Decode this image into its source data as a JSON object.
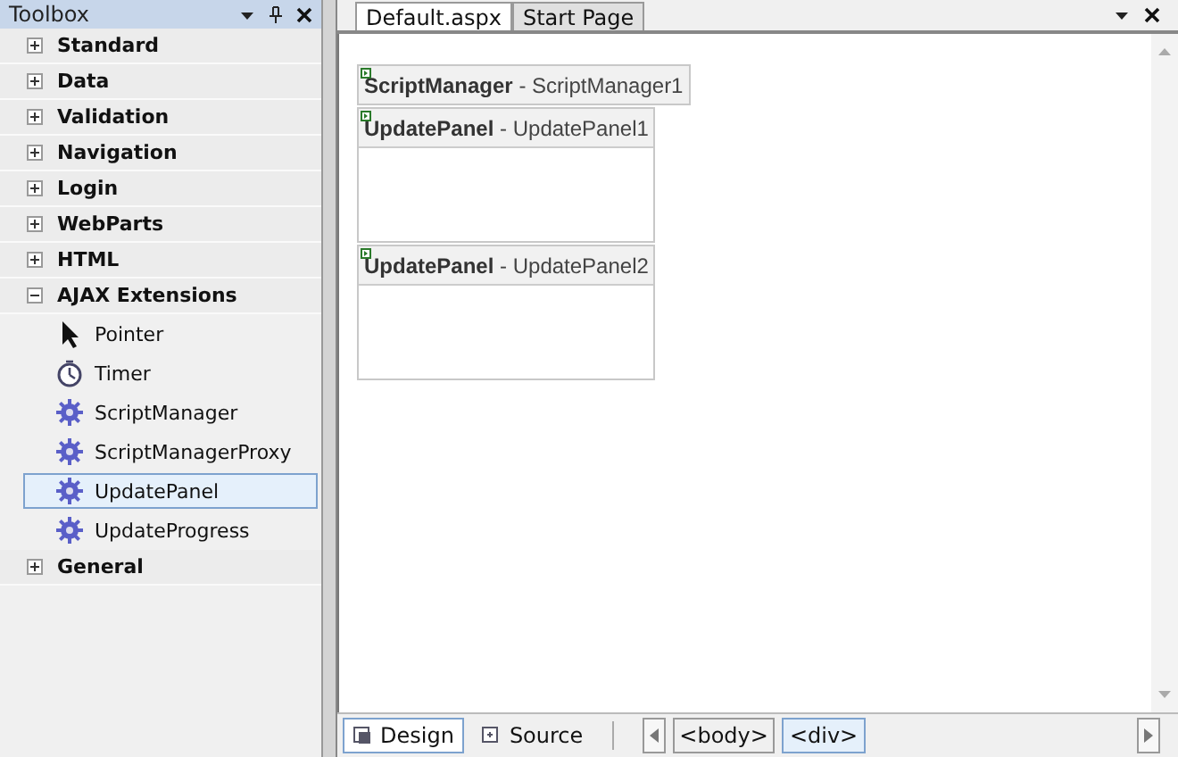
{
  "toolbox": {
    "title": "Toolbox",
    "categories": [
      {
        "label": "Standard",
        "expanded": false
      },
      {
        "label": "Data",
        "expanded": false
      },
      {
        "label": "Validation",
        "expanded": false
      },
      {
        "label": "Navigation",
        "expanded": false
      },
      {
        "label": "Login",
        "expanded": false
      },
      {
        "label": "WebParts",
        "expanded": false
      },
      {
        "label": "HTML",
        "expanded": false
      },
      {
        "label": "AJAX Extensions",
        "expanded": true,
        "children": [
          {
            "label": "Pointer",
            "kind": "pointer",
            "selected": false
          },
          {
            "label": "Timer",
            "kind": "timer",
            "selected": false
          },
          {
            "label": "ScriptManager",
            "kind": "gear",
            "selected": false
          },
          {
            "label": "ScriptManagerProxy",
            "kind": "gear",
            "selected": false
          },
          {
            "label": "UpdatePanel",
            "kind": "gear",
            "selected": true
          },
          {
            "label": "UpdateProgress",
            "kind": "gear",
            "selected": false
          }
        ]
      },
      {
        "label": "General",
        "expanded": false
      }
    ]
  },
  "editor": {
    "tabs": [
      {
        "label": "Default.aspx",
        "selected": true
      },
      {
        "label": "Start Page",
        "selected": false
      }
    ],
    "controls": [
      {
        "label": "**ScriptManager** - ScriptManager1",
        "kind": "component"
      },
      {
        "label": "**UpdatePanel** - UpdatePanel1",
        "kind": "panel"
      },
      {
        "label": "**UpdatePanel** - UpdatePanel2",
        "kind": "panel"
      }
    ],
    "views": [
      {
        "label": "Design",
        "selected": true
      },
      {
        "label": "Source",
        "selected": false
      }
    ],
    "tag_path": [
      {
        "label": "<body>",
        "selected": false
      },
      {
        "label": "<div>",
        "selected": true
      }
    ]
  }
}
